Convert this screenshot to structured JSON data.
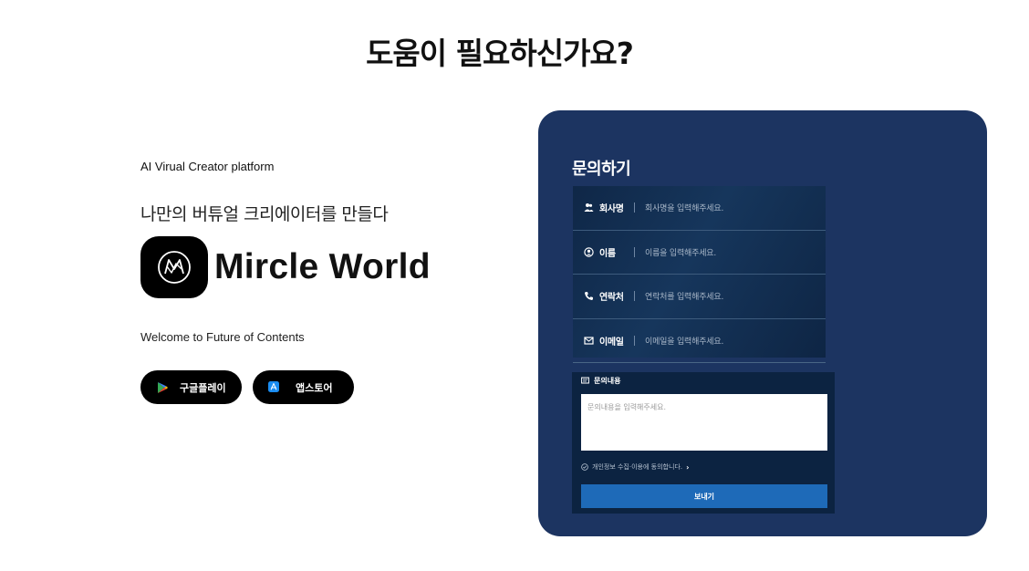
{
  "page": {
    "title": "도움이 필요하신가요?"
  },
  "hero": {
    "tagline": "AI Virual Creator  platform",
    "subtitle": "나만의 버튜얼 크리에이터를 만들다",
    "brand_name": "Mircle World",
    "welcome": "Welcome to Future of Contents",
    "buttons": [
      {
        "label": "구글플레이",
        "icon": "google-play-icon"
      },
      {
        "label": "앱스토어",
        "icon": "app-store-icon"
      }
    ]
  },
  "form": {
    "title": "문의하기",
    "fields": [
      {
        "label": "회사명",
        "placeholder": "회사명을 입력해주세요.",
        "icon": "users-icon"
      },
      {
        "label": "이름",
        "placeholder": "이름을 입력해주세요.",
        "icon": "user-icon"
      },
      {
        "label": "연락처",
        "placeholder": "연락처를 입력해주세요.",
        "icon": "phone-icon"
      },
      {
        "label": "이메일",
        "placeholder": "이메일을 입력해주세요.",
        "icon": "mail-icon"
      }
    ],
    "inquiry": {
      "label": "문의내용",
      "placeholder": "문의내용을 입력해주세요.",
      "icon": "message-icon"
    },
    "consent": "개인정보 수집·이용에 동의합니다.",
    "submit": "보내기"
  },
  "colors": {
    "card_bg": "#1c3461",
    "submit_bg": "#1e6ab8",
    "button_bg": "#000000"
  }
}
